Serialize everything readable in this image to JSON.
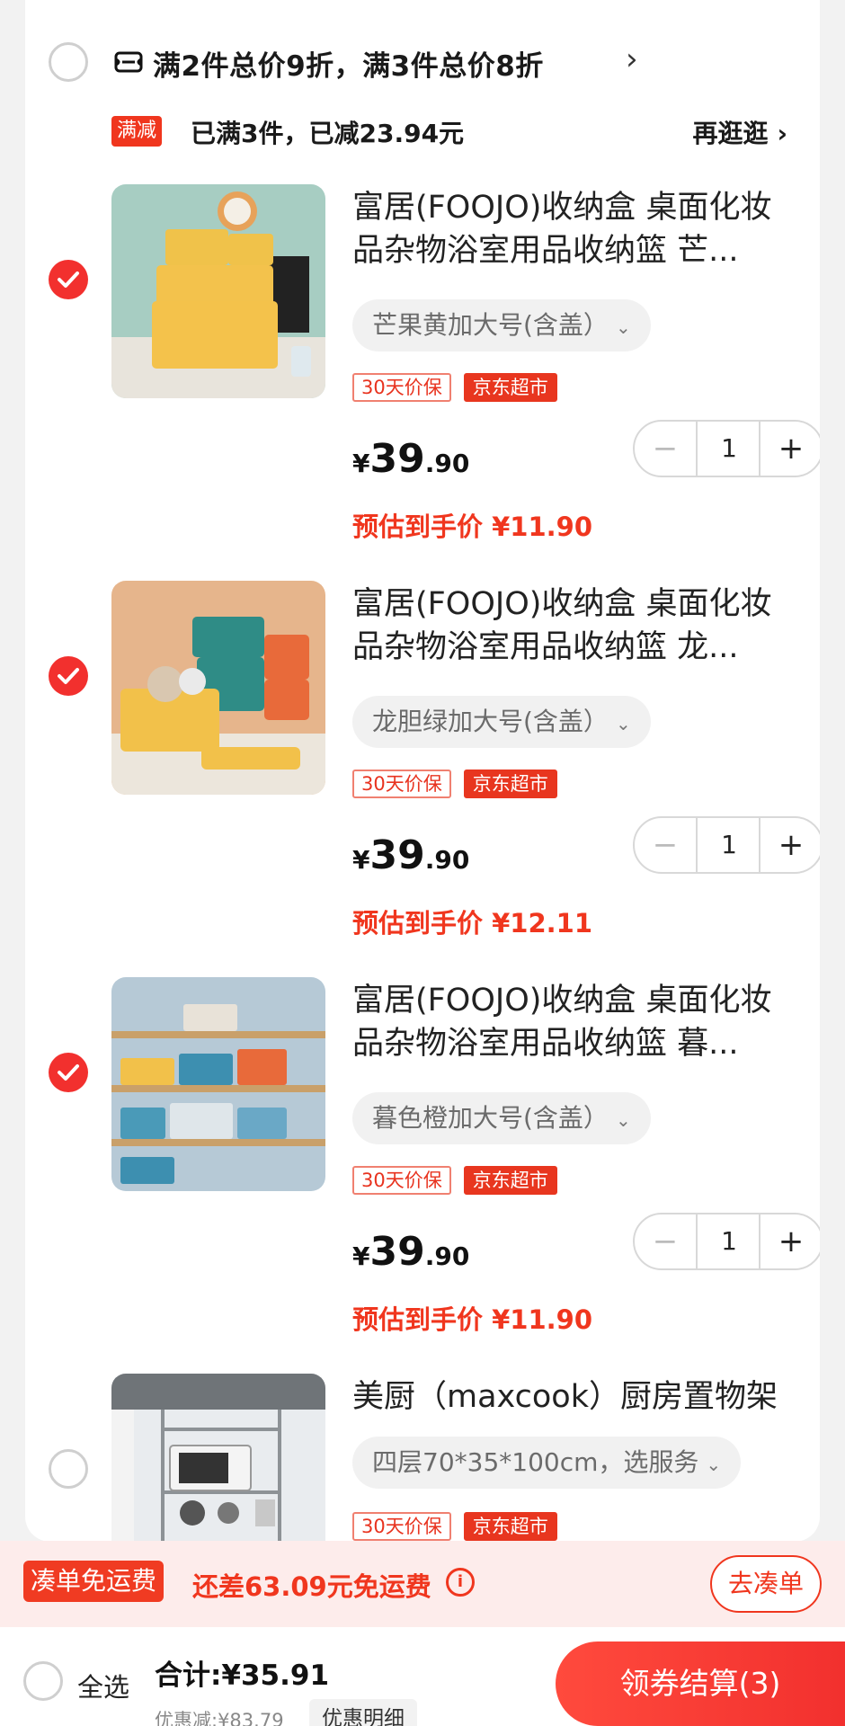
{
  "promo": {
    "text": "满2件总价9折，满3件总价8折",
    "tag": "满减",
    "status": "已满3件，已减23.94元",
    "more_link": "再逛逛"
  },
  "items": [
    {
      "title": "富居(FOOJO)收纳盒 桌面化妆品杂物浴室用品收纳篮 芒...",
      "spec": "芒果黄加大号(含盖）",
      "badge_guarantee": "30天价保",
      "badge_store": "京东超市",
      "price_currency": "¥",
      "price_int": "39",
      "price_dec": ".90",
      "est_price": "预估到手价 ¥11.90",
      "qty": "1",
      "checked": true
    },
    {
      "title": "富居(FOOJO)收纳盒 桌面化妆品杂物浴室用品收纳篮 龙...",
      "spec": "龙胆绿加大号(含盖）",
      "badge_guarantee": "30天价保",
      "badge_store": "京东超市",
      "price_currency": "¥",
      "price_int": "39",
      "price_dec": ".90",
      "est_price": "预估到手价 ¥12.11",
      "qty": "1",
      "checked": true
    },
    {
      "title": "富居(FOOJO)收纳盒 桌面化妆品杂物浴室用品收纳篮 暮...",
      "spec": "暮色橙加大号(含盖）",
      "badge_guarantee": "30天价保",
      "badge_store": "京东超市",
      "price_currency": "¥",
      "price_int": "39",
      "price_dec": ".90",
      "est_price": "预估到手价 ¥11.90",
      "qty": "1",
      "checked": true
    },
    {
      "title": "美厨（maxcook）厨房置物架",
      "spec": "四层70*35*100cm，选服务",
      "badge_guarantee": "30天价保",
      "badge_store": "京东超市",
      "checked": false
    }
  ],
  "shipping": {
    "tag": "凑单免运费",
    "text": "还差63.09元免运费",
    "button": "去凑单"
  },
  "footer": {
    "select_all": "全选",
    "total": "合计:¥35.91",
    "discount": "优惠减:¥83.79",
    "detail_button": "优惠明细",
    "pay_button": "领券结算(3)"
  },
  "colors": {
    "accent": "#f2302e",
    "accent_text": "#f0361e"
  }
}
